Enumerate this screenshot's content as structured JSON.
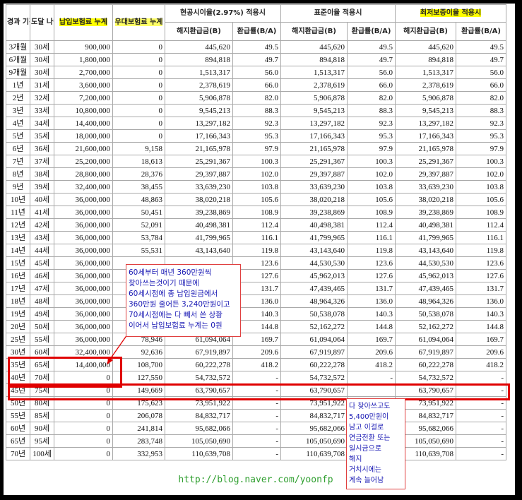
{
  "headers": {
    "elapsed": "경과 기간",
    "age": "도달 나이",
    "paid": "납입보험료 누계",
    "bonus": "우대보험료 누계",
    "current_rate": "현공시이율(2.97%) 적용시",
    "standard_rate": "표준이율 적용시",
    "min_rate": "최저보증이율 적용시",
    "surrender": "해지환급금(B)",
    "ratio": "환급률(B/A)"
  },
  "rows": [
    {
      "period": "3개월",
      "age": "30세",
      "paid": "900,000",
      "bonus": "0",
      "v1": "445,620",
      "r1": "49.5",
      "v2": "445,620",
      "r2": "49.5",
      "v3": "445,620",
      "r3": "49.5"
    },
    {
      "period": "6개월",
      "age": "30세",
      "paid": "1,800,000",
      "bonus": "0",
      "v1": "894,818",
      "r1": "49.7",
      "v2": "894,818",
      "r2": "49.7",
      "v3": "894,818",
      "r3": "49.7"
    },
    {
      "period": "9개월",
      "age": "30세",
      "paid": "2,700,000",
      "bonus": "0",
      "v1": "1,513,317",
      "r1": "56.0",
      "v2": "1,513,317",
      "r2": "56.0",
      "v3": "1,513,317",
      "r3": "56.0"
    },
    {
      "period": "1년",
      "age": "31세",
      "paid": "3,600,000",
      "bonus": "0",
      "v1": "2,378,619",
      "r1": "66.0",
      "v2": "2,378,619",
      "r2": "66.0",
      "v3": "2,378,619",
      "r3": "66.0"
    },
    {
      "period": "2년",
      "age": "32세",
      "paid": "7,200,000",
      "bonus": "0",
      "v1": "5,906,878",
      "r1": "82.0",
      "v2": "5,906,878",
      "r2": "82.0",
      "v3": "5,906,878",
      "r3": "82.0"
    },
    {
      "period": "3년",
      "age": "33세",
      "paid": "10,800,000",
      "bonus": "0",
      "v1": "9,545,213",
      "r1": "88.3",
      "v2": "9,545,213",
      "r2": "88.3",
      "v3": "9,545,213",
      "r3": "88.3"
    },
    {
      "period": "4년",
      "age": "34세",
      "paid": "14,400,000",
      "bonus": "0",
      "v1": "13,297,182",
      "r1": "92.3",
      "v2": "13,297,182",
      "r2": "92.3",
      "v3": "13,297,182",
      "r3": "92.3"
    },
    {
      "period": "5년",
      "age": "35세",
      "paid": "18,000,000",
      "bonus": "0",
      "v1": "17,166,343",
      "r1": "95.3",
      "v2": "17,166,343",
      "r2": "95.3",
      "v3": "17,166,343",
      "r3": "95.3"
    },
    {
      "period": "6년",
      "age": "36세",
      "paid": "21,600,000",
      "bonus": "9,158",
      "v1": "21,165,978",
      "r1": "97.9",
      "v2": "21,165,978",
      "r2": "97.9",
      "v3": "21,165,978",
      "r3": "97.9"
    },
    {
      "period": "7년",
      "age": "37세",
      "paid": "25,200,000",
      "bonus": "18,613",
      "v1": "25,291,367",
      "r1": "100.3",
      "v2": "25,291,367",
      "r2": "100.3",
      "v3": "25,291,367",
      "r3": "100.3"
    },
    {
      "period": "8년",
      "age": "38세",
      "paid": "28,800,000",
      "bonus": "28,376",
      "v1": "29,397,887",
      "r1": "102.0",
      "v2": "29,397,887",
      "r2": "102.0",
      "v3": "29,397,887",
      "r3": "102.0"
    },
    {
      "period": "9년",
      "age": "39세",
      "paid": "32,400,000",
      "bonus": "38,455",
      "v1": "33,639,230",
      "r1": "103.8",
      "v2": "33,639,230",
      "r2": "103.8",
      "v3": "33,639,230",
      "r3": "103.8"
    },
    {
      "period": "10년",
      "age": "40세",
      "paid": "36,000,000",
      "bonus": "48,863",
      "v1": "38,020,218",
      "r1": "105.6",
      "v2": "38,020,218",
      "r2": "105.6",
      "v3": "38,020,218",
      "r3": "105.6"
    },
    {
      "period": "11년",
      "age": "41세",
      "paid": "36,000,000",
      "bonus": "50,451",
      "v1": "39,238,869",
      "r1": "108.9",
      "v2": "39,238,869",
      "r2": "108.9",
      "v3": "39,238,869",
      "r3": "108.9"
    },
    {
      "period": "12년",
      "age": "42세",
      "paid": "36,000,000",
      "bonus": "52,091",
      "v1": "40,498,381",
      "r1": "112.4",
      "v2": "40,498,381",
      "r2": "112.4",
      "v3": "40,498,381",
      "r3": "112.4"
    },
    {
      "period": "13년",
      "age": "43세",
      "paid": "36,000,000",
      "bonus": "53,784",
      "v1": "41,799,965",
      "r1": "116.1",
      "v2": "41,799,965",
      "r2": "116.1",
      "v3": "41,799,965",
      "r3": "116.1"
    },
    {
      "period": "14년",
      "age": "44세",
      "paid": "36,000,000",
      "bonus": "55,531",
      "v1": "43,143,640",
      "r1": "119.8",
      "v2": "43,143,640",
      "r2": "119.8",
      "v3": "43,143,640",
      "r3": "119.8"
    },
    {
      "period": "15년",
      "age": "45세",
      "paid": "36,000,000",
      "bonus": "",
      "v1": "",
      "r1": "123.6",
      "v2": "44,530,530",
      "r2": "123.6",
      "v3": "44,530,530",
      "r3": "123.6"
    },
    {
      "period": "16년",
      "age": "46세",
      "paid": "36,000,000",
      "bonus": "",
      "v1": "",
      "r1": "127.6",
      "v2": "45,962,013",
      "r2": "127.6",
      "v3": "45,962,013",
      "r3": "127.6"
    },
    {
      "period": "17년",
      "age": "47세",
      "paid": "36,000,000",
      "bonus": "",
      "v1": "",
      "r1": "131.7",
      "v2": "47,439,465",
      "r2": "131.7",
      "v3": "47,439,465",
      "r3": "131.7"
    },
    {
      "period": "18년",
      "age": "48세",
      "paid": "36,000,000",
      "bonus": "",
      "v1": "",
      "r1": "136.0",
      "v2": "48,964,326",
      "r2": "136.0",
      "v3": "48,964,326",
      "r3": "136.0"
    },
    {
      "period": "19년",
      "age": "49세",
      "paid": "36,000,000",
      "bonus": "",
      "v1": "",
      "r1": "140.3",
      "v2": "50,538,078",
      "r2": "140.3",
      "v3": "50,538,078",
      "r3": "140.3"
    },
    {
      "period": "20년",
      "age": "50세",
      "paid": "36,000,000",
      "bonus": "67,279",
      "v1": "52,162,272",
      "r1": "144.8",
      "v2": "52,162,272",
      "r2": "144.8",
      "v3": "52,162,272",
      "r3": "144.8"
    },
    {
      "period": "25년",
      "age": "55세",
      "paid": "36,000,000",
      "bonus": "78,946",
      "v1": "61,094,064",
      "r1": "169.7",
      "v2": "61,094,064",
      "r2": "169.7",
      "v3": "61,094,064",
      "r3": "169.7"
    },
    {
      "period": "30년",
      "age": "60세",
      "paid": "32,400,000",
      "bonus": "92,636",
      "v1": "67,919,897",
      "r1": "209.6",
      "v2": "67,919,897",
      "r2": "209.6",
      "v3": "67,919,897",
      "r3": "209.6"
    },
    {
      "period": "35년",
      "age": "65세",
      "paid": "14,400,000",
      "bonus": "108,700",
      "v1": "60,222,278",
      "r1": "418.2",
      "v2": "60,222,278",
      "r2": "418.2",
      "v3": "60,222,278",
      "r3": "418.2"
    },
    {
      "period": "40년",
      "age": "70세",
      "paid": "0",
      "bonus": "127,550",
      "v1": "54,732,572",
      "r1": "-",
      "v2": "54,732,572",
      "r2": "-",
      "v3": "54,732,572",
      "r3": "-"
    },
    {
      "period": "45년",
      "age": "75세",
      "paid": "0",
      "bonus": "149,669",
      "v1": "63,790,657",
      "r1": "-",
      "v2": "63,790,657",
      "r2": "",
      "v3": "63,790,657",
      "r3": "-"
    },
    {
      "period": "50년",
      "age": "80세",
      "paid": "0",
      "bonus": "175,623",
      "v1": "73,951,922",
      "r1": "-",
      "v2": "73,951,922",
      "r2": "",
      "v3": "73,951,922",
      "r3": "-"
    },
    {
      "period": "55년",
      "age": "85세",
      "paid": "0",
      "bonus": "206,078",
      "v1": "84,832,717",
      "r1": "-",
      "v2": "84,832,717",
      "r2": "",
      "v3": "84,832,717",
      "r3": "-"
    },
    {
      "period": "60년",
      "age": "90세",
      "paid": "0",
      "bonus": "241,814",
      "v1": "95,682,066",
      "r1": "-",
      "v2": "95,682,066",
      "r2": "",
      "v3": "95,682,066",
      "r3": "-"
    },
    {
      "period": "65년",
      "age": "95세",
      "paid": "0",
      "bonus": "283,748",
      "v1": "105,050,690",
      "r1": "-",
      "v2": "105,050,690",
      "r2": "",
      "v3": "105,050,690",
      "r3": "-"
    },
    {
      "period": "70년",
      "age": "100세",
      "paid": "0",
      "bonus": "332,953",
      "v1": "110,639,708",
      "r1": "-",
      "v2": "110,639,708",
      "r2": "",
      "v3": "110,639,708",
      "r3": "-"
    }
  ],
  "note_left": [
    "60세부터 매년 360만원씩",
    "찾아쓰는것이기 때문에",
    "60세시점에 총 납입원금에서",
    "360만원 줄어든 3,240만원이고",
    "70세시점에는 다 빼서 쓴 상황",
    "이어서 납입보험료 누계는 0원"
  ],
  "note_right": [
    "다 찾아쓰고도",
    "5,400만원이",
    "남고 이걸로",
    "연금전환 또는",
    "일시금으로",
    "해지",
    "거치시에는",
    "계속 늘어남"
  ],
  "footer_url": "http://blog.naver.com/yoonfp",
  "colors": {
    "highlight": "#ffff00",
    "annotation_red": "#e00000",
    "note_text": "#1a1ab4",
    "url_green": "#2f9f2f"
  }
}
